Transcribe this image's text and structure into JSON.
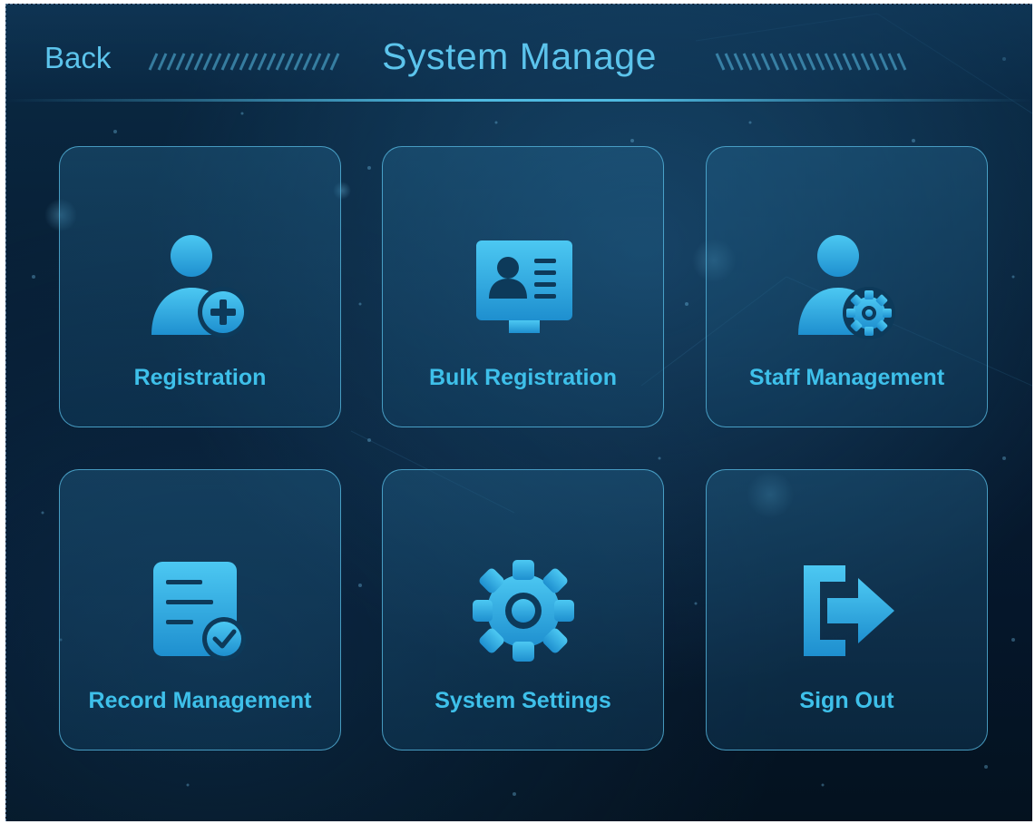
{
  "header": {
    "back_label": "Back",
    "title": "System Manage"
  },
  "colors": {
    "accent": "#3ec0ea",
    "background": "#071d33",
    "tile_border": "#5abee6"
  },
  "tiles": [
    {
      "label": "Registration",
      "icon": "user-add-icon"
    },
    {
      "label": "Bulk Registration",
      "icon": "id-card-icon"
    },
    {
      "label": "Staff Management",
      "icon": "user-settings-icon"
    },
    {
      "label": "Record Management",
      "icon": "document-check-icon"
    },
    {
      "label": "System Settings",
      "icon": "gear-icon"
    },
    {
      "label": "Sign Out",
      "icon": "sign-out-icon"
    }
  ]
}
